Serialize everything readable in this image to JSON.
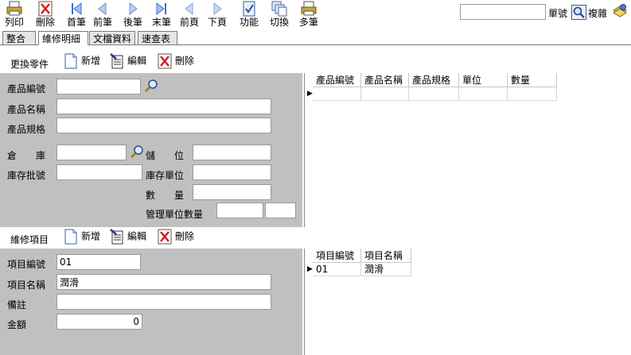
{
  "toolbar": {
    "items": [
      {
        "label": "列印",
        "icon": "print-icon"
      },
      {
        "label": "刪除",
        "icon": "delete-icon"
      },
      {
        "label": "首筆",
        "icon": "first-record-icon"
      },
      {
        "label": "前筆",
        "icon": "prev-record-icon"
      },
      {
        "label": "後筆",
        "icon": "next-record-icon"
      },
      {
        "label": "末筆",
        "icon": "last-record-icon"
      },
      {
        "label": "前頁",
        "icon": "prev-page-icon"
      },
      {
        "label": "下頁",
        "icon": "next-page-icon"
      },
      {
        "label": "功能",
        "icon": "function-icon"
      },
      {
        "label": "切換",
        "icon": "switch-icon"
      },
      {
        "label": "多筆",
        "icon": "multi-record-icon"
      }
    ],
    "search_value": "",
    "doc_no_label": "單號",
    "copy_label": "複雜"
  },
  "tabs": [
    "整合",
    "維修明細",
    "文檔資料",
    "速查表"
  ],
  "parts": {
    "title": "更換零件",
    "new_label": "新增",
    "edit_label": "編輯",
    "delete_label": "刪除",
    "fields": {
      "product_no": {
        "label": "產品編號",
        "value": ""
      },
      "product_name": {
        "label": "產品名稱",
        "value": ""
      },
      "product_spec": {
        "label": "產品規格",
        "value": ""
      },
      "warehouse": {
        "label": "倉　　庫",
        "value": ""
      },
      "location": {
        "label": "儲　　位",
        "value": ""
      },
      "batch_no": {
        "label": "庫存批號",
        "value": ""
      },
      "stock_unit": {
        "label": "庫存單位",
        "value": ""
      },
      "quantity": {
        "label": "數　　量",
        "value": ""
      },
      "mgmt_qty": {
        "label": "管理單位數量",
        "value": "",
        "value2": ""
      }
    },
    "grid": {
      "headers": [
        "產品編號",
        "產品名稱",
        "產品規格",
        "單位",
        "數量"
      ],
      "rows": [
        [
          "",
          "",
          "",
          "",
          ""
        ]
      ]
    }
  },
  "items": {
    "title": "維修項目",
    "new_label": "新增",
    "edit_label": "編輯",
    "delete_label": "刪除",
    "fields": {
      "item_no": {
        "label": "項目編號",
        "value": "01"
      },
      "item_name": {
        "label": "項目名稱",
        "value": "潤滑"
      },
      "remark": {
        "label": "備註",
        "value": ""
      },
      "amount": {
        "label": "金額",
        "value": "0"
      }
    },
    "grid": {
      "headers": [
        "項目編號",
        "項目名稱"
      ],
      "rows": [
        [
          "01",
          "潤滑"
        ]
      ]
    }
  }
}
